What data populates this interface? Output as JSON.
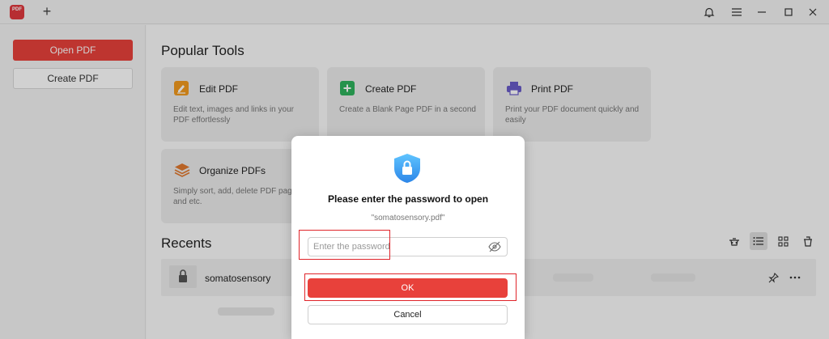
{
  "titlebar": {
    "logo_text": "PDF",
    "new_tab_label": "+",
    "controls": [
      "bell-icon",
      "menu-icon",
      "minimize-icon",
      "maximize-icon",
      "close-icon"
    ]
  },
  "sidebar": {
    "open_label": "Open PDF",
    "create_label": "Create PDF"
  },
  "popular_tools": {
    "title": "Popular Tools",
    "tools": [
      {
        "name": "Edit PDF",
        "desc": "Edit text, images and links in your PDF effortlessly",
        "icon": "edit-icon"
      },
      {
        "name": "Create PDF",
        "desc": "Create a Blank Page PDF in a second",
        "icon": "plus-icon"
      },
      {
        "name": "Print PDF",
        "desc": "Print your PDF document quickly and easily",
        "icon": "printer-icon"
      },
      {
        "name": "Organize PDFs",
        "desc": "Simply sort, add, delete PDF pages and etc.",
        "icon": "layers-icon"
      }
    ]
  },
  "recents": {
    "title": "Recents",
    "files": [
      {
        "name": "somatosensory"
      }
    ]
  },
  "dialog": {
    "title": "Please enter the password to open",
    "filename": "\"somatosensory.pdf\"",
    "password_placeholder": "Enter the password",
    "password_value": "",
    "ok_label": "OK",
    "cancel_label": "Cancel"
  },
  "colors": {
    "accent": "#e8413b",
    "shield": "#3b9ef0",
    "annotation": "#e0242a"
  }
}
